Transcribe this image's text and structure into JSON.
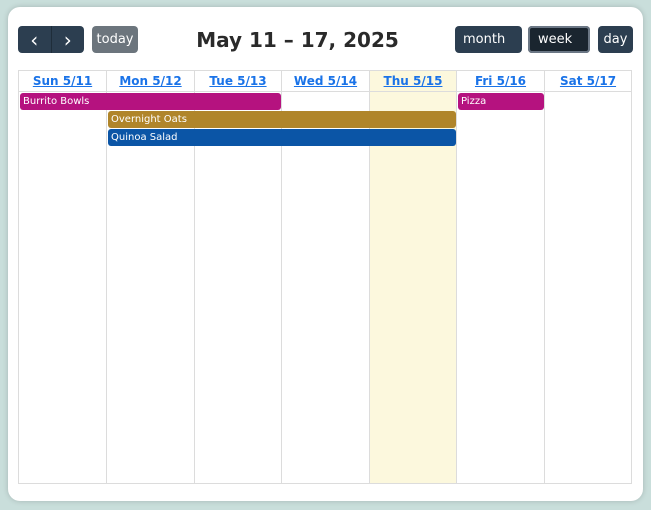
{
  "toolbar": {
    "prev_icon": "chevron-left-icon",
    "next_icon": "chevron-right-icon",
    "prev_glyph": "‹",
    "next_glyph": "›",
    "today_label": "today",
    "title": "May 11 – 17, 2025",
    "views": {
      "month": "month",
      "week": "week",
      "day": "day"
    },
    "active_view": "week"
  },
  "columns": [
    {
      "label": "Sun 5/11",
      "today": false
    },
    {
      "label": "Mon 5/12",
      "today": false
    },
    {
      "label": "Tue 5/13",
      "today": false
    },
    {
      "label": "Wed 5/14",
      "today": false
    },
    {
      "label": "Thu 5/15",
      "today": true
    },
    {
      "label": "Fri 5/16",
      "today": false
    },
    {
      "label": "Sat 5/17",
      "today": false
    }
  ],
  "events": [
    {
      "title": "Burrito Bowls",
      "color": "#b5127f",
      "start_day": "Sun 5/11",
      "end_day": "Tue 5/13"
    },
    {
      "title": "Pizza",
      "color": "#b5127f",
      "start_day": "Fri 5/16",
      "end_day": "Fri 5/16"
    },
    {
      "title": "Overnight Oats",
      "color": "#b0852a",
      "start_day": "Mon 5/12",
      "end_day": "Thu 5/15"
    },
    {
      "title": "Quinoa Salad",
      "color": "#0b55a6",
      "start_day": "Mon 5/12",
      "end_day": "Thu 5/15"
    }
  ],
  "colors": {
    "button_bg": "#2c3e50",
    "today_button_bg": "#6c757d",
    "today_column_bg": "#fcf8dd",
    "header_link": "#1a73e8"
  }
}
